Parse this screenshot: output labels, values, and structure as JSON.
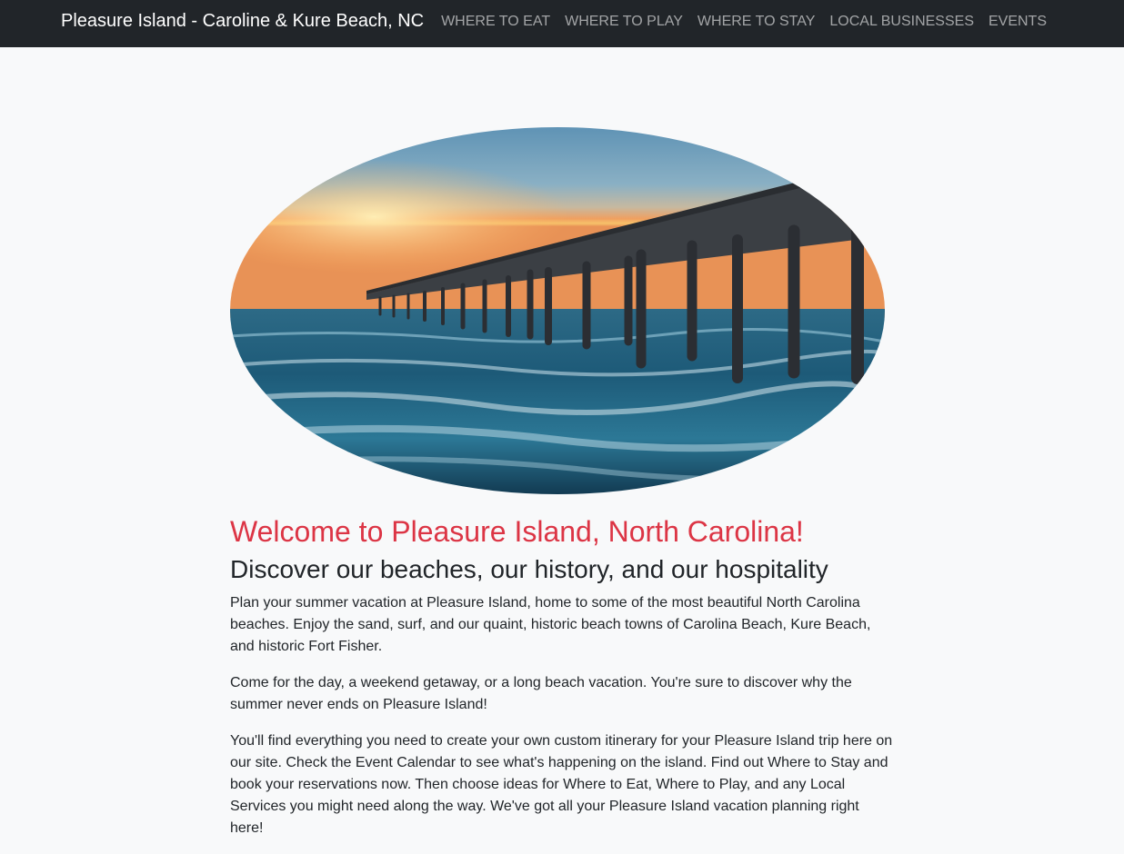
{
  "navbar": {
    "brand": "Pleasure Island - Caroline & Kure Beach, NC",
    "links": [
      "Where to Eat",
      "Where to Play",
      "Where to Stay",
      "Local Businesses",
      "Events"
    ]
  },
  "main": {
    "heading": "Welcome to Pleasure Island, North Carolina!",
    "subheading": "Discover our beaches, our history, and our hospitality",
    "paragraphs": [
      "Plan your summer vacation at Pleasure Island, home to some of the most beautiful North Carolina beaches. Enjoy the sand, surf, and our quaint, historic beach towns of Carolina Beach, Kure Beach, and historic Fort Fisher.",
      "Come for the day, a weekend getaway, or a long beach vacation. You're sure to discover why the summer never ends on Pleasure Island!",
      "You'll find everything you need to create your own custom itinerary for your Pleasure Island trip here on our site. Check the Event Calendar to see what's happening on the island. Find out Where to Stay and book your reservations now. Then choose ideas for Where to Eat, Where to Play, and any Local Services you might need along the way. We've got all your Pleasure Island vacation planning right here!"
    ]
  },
  "colors": {
    "navbar_bg": "#212529",
    "page_bg": "#f8f9fa",
    "heading_red": "#dc3545",
    "nav_link": "rgba(255,255,255,0.58)"
  },
  "hero_image": {
    "icon": "pier-sunset-photo"
  }
}
